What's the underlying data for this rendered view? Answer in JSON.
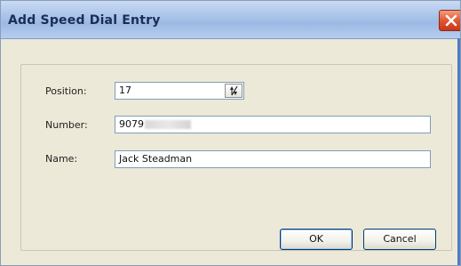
{
  "window": {
    "title": "Add Speed Dial Entry"
  },
  "form": {
    "position_label": "Position:",
    "position_value": "17",
    "number_label": "Number:",
    "number_value": "9079",
    "name_label": "Name:",
    "name_value": "Jack Steadman"
  },
  "buttons": {
    "ok_label": "OK",
    "cancel_label": "Cancel"
  },
  "icons": {
    "close": "close-icon",
    "spinner": "spin-updown-icon"
  },
  "colors": {
    "titlebar": "#aac4ea",
    "close_button": "#e0532d",
    "dialog_bg": "#ece9d8",
    "field_border": "#7f9db9",
    "button_border": "#003c74"
  }
}
